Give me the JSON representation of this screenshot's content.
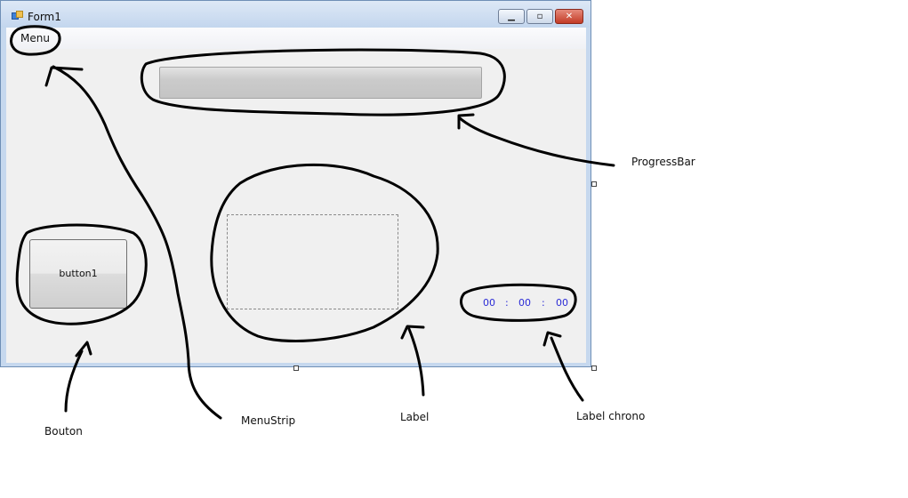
{
  "window": {
    "title": "Form1",
    "icon": "form-icon"
  },
  "window_controls": {
    "minimize": "minimize-icon",
    "maximize": "maximize-icon",
    "close": "close-icon"
  },
  "menu": {
    "label": "Menu"
  },
  "progressbar": {
    "value": 0
  },
  "button1": {
    "label": "button1"
  },
  "chrono": {
    "h": "00",
    "sep1": ":",
    "m": "00",
    "sep2": ":",
    "s": "00"
  },
  "annotations": {
    "progressbar": "ProgressBar",
    "bouton": "Bouton",
    "menustrip": "MenuStrip",
    "label": "Label",
    "label_chrono": "Label chrono"
  },
  "colors": {
    "chrono_text": "#2b2bd6",
    "annotation_ink": "#000000",
    "titlebar": "#c6d8ee"
  }
}
